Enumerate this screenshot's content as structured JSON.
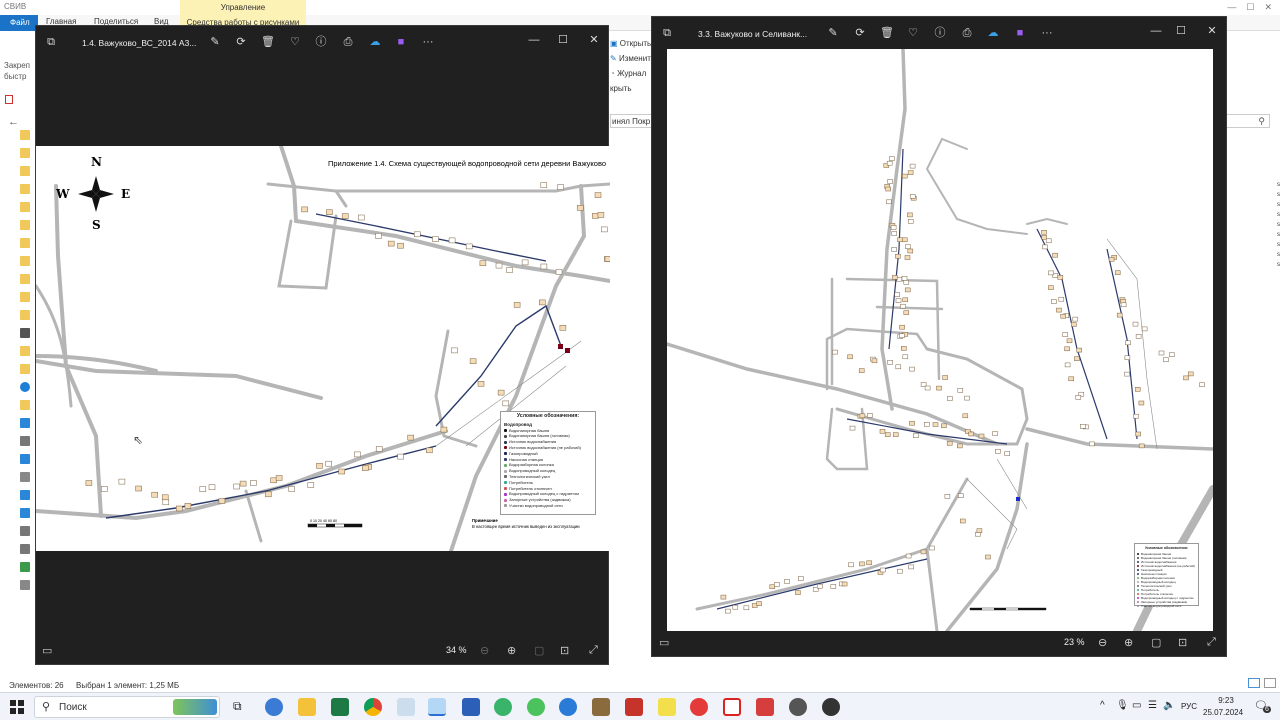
{
  "explorer": {
    "title": "СВИВ",
    "file_tab": "Файл",
    "tabs": [
      "Главная",
      "Поделиться",
      "Вид"
    ],
    "context_group": "Управление",
    "context_tab": "Средства работы с рисунками",
    "right_menu": [
      "Открыть",
      "Изменить",
      "Журнал",
      "крыть"
    ],
    "left_cut_text": [
      "Закреп",
      "быстр"
    ],
    "path_fragment": "инял Покр",
    "status_items": "Элементов: 26",
    "status_selected": "Выбран 1 элемент: 1,25 МБ"
  },
  "window1": {
    "title": "1.4. Важуково_ВС_2014 А3...",
    "zoom": "34 %",
    "map": {
      "heading": "Приложение 1.4. Схема существующей водопроводной сети деревни Важуково",
      "compass": {
        "n": "N",
        "s": "S",
        "e": "E",
        "w": "W"
      },
      "legend_title": "Условные обозначения:",
      "legend_section": "Водопровод",
      "legend_items": [
        "Водонапорная башня",
        "Водонапорная башня (головная)",
        "Источник водоснабжения",
        "Источник водоснабжения (не рабочий)",
        "Газопроводный",
        "Насосная станция",
        "Водоразборная колонка",
        "Водопроводный колодец",
        "Технологический узел",
        "Потребитель",
        "Потребитель отключен",
        "Водопроводный колодец с гидрантом",
        "Запорные устройства (задвижка)",
        "Участки водопроводной сети"
      ],
      "note_title": "Примечание",
      "note_text": "В настоящее время источник выведен из эксплуатации",
      "scale_text": "0 10 20 40 60 80"
    }
  },
  "window2": {
    "title": "3.3. Важуково и Селиванк...",
    "zoom": "23 %",
    "legend_title": "Условные обозначения:"
  },
  "taskbar": {
    "search_placeholder": "Поиск",
    "lang": "РУС",
    "time": "9:23",
    "date": "25.07.2024",
    "notifications": "6"
  },
  "colors": {
    "window_bg": "#202020",
    "road": "#b0b0b0",
    "building": "#f3dcb7",
    "building_border": "#7b6040",
    "pipe": "#2b3a6b",
    "taskbar": "#f0f3f9"
  }
}
